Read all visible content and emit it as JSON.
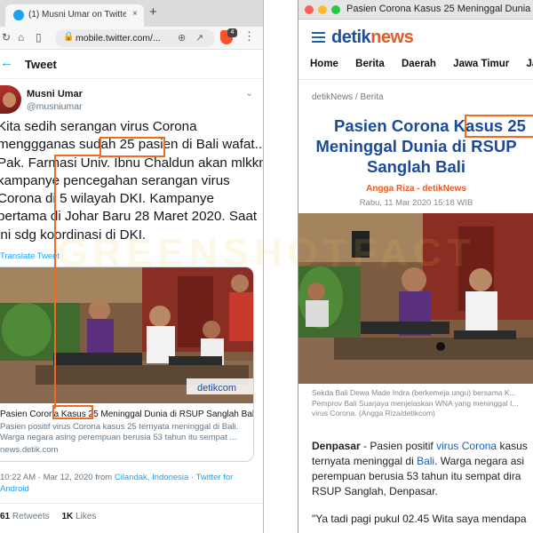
{
  "left_browser": {
    "tab_title": "(1) Musni Umar on Twitter: \"Kita s...",
    "tab_close": "×",
    "new_tab": "+",
    "url": "mobile.twitter.com/...",
    "brave_badge": "4",
    "header_title": "Tweet",
    "user": {
      "name": "Musni Umar",
      "handle": "@musniumar"
    },
    "tweet_lines": [
      "Kita sedih serangan virus Corona",
      "menggganas sudah 25 pasien di Bali wafat..",
      "Pak. Farmasi Univ. Ibnu Chaldun akan mlkkn",
      "kampanye pencegahan serangan virus",
      "Corona di 5 wilayah DKI. Kampanye",
      "pertama di Johar Baru 28 Maret 2020. Saat",
      "ini sdg koordinasi di DKI."
    ],
    "translate_label": "Translate Tweet",
    "card": {
      "brand": "detikcom",
      "title": "Pasien Corona Kasus 25 Meninggal Dunia di RSUP Sanglah Bali",
      "description": "Pasien positif virus Corona kasus 25 ternyata meninggal di Bali. Warga negara asing perempuan berusia 53 tahun itu sempat ...",
      "domain": "news.detik.com"
    },
    "meta_time": "10:22 AM · Mar 12, 2020 from ",
    "meta_place": "Cilandak, Indonesia",
    "meta_sep": " · ",
    "meta_client": "Twitter for Android",
    "retweets_count": "61",
    "retweets_label": "Retweets",
    "likes_count": "1K",
    "likes_label": "Likes"
  },
  "right_browser": {
    "window_title": "Pasien Corona Kasus 25 Meninggal Dunia di RSUP",
    "logo_a": "detik",
    "logo_b": "news",
    "nav": [
      "Home",
      "Berita",
      "Daerah",
      "Jawa Timur",
      "Ja"
    ],
    "breadcrumb": "detikNews / Berita",
    "headline_lines": [
      "Pasien Corona Kasus 25",
      "Meninggal Dunia di RSUP",
      "Sanglah Bali"
    ],
    "author": "Angga Riza - detikNews",
    "date": "Rabu, 11 Mar 2020 15:18 WIB",
    "caption": "Sekda Bali Dewa Made Indra (berkemeja ungu) bersama K... Pemprov Bali Suarjaya menjelaskan WNA yang meninggal I... virus Corona. (Angga Riza/detikcom)",
    "article_lead": "Denpasar",
    "article_parts": {
      "p1": " - Pasien positif ",
      "link1": "virus Corona",
      "p2": " kasus",
      "p3": "ternyata meninggal di ",
      "link2": "Bali",
      "p4": ". Warga negara asi",
      "p5": "perempuan berusia 53 tahun itu sempat dira",
      "p6": "RSUP Sanglah, Denpasar."
    },
    "quote": "\"Ya tadi pagi pukul 02.45 Wita saya mendapa"
  },
  "watermark": "GREENSHOTFACT",
  "colors": {
    "twitter_blue": "#1da1f2",
    "detik_blue": "#1b4a99",
    "detik_orange": "#e25b2a",
    "highlight": "#f26a1f"
  }
}
